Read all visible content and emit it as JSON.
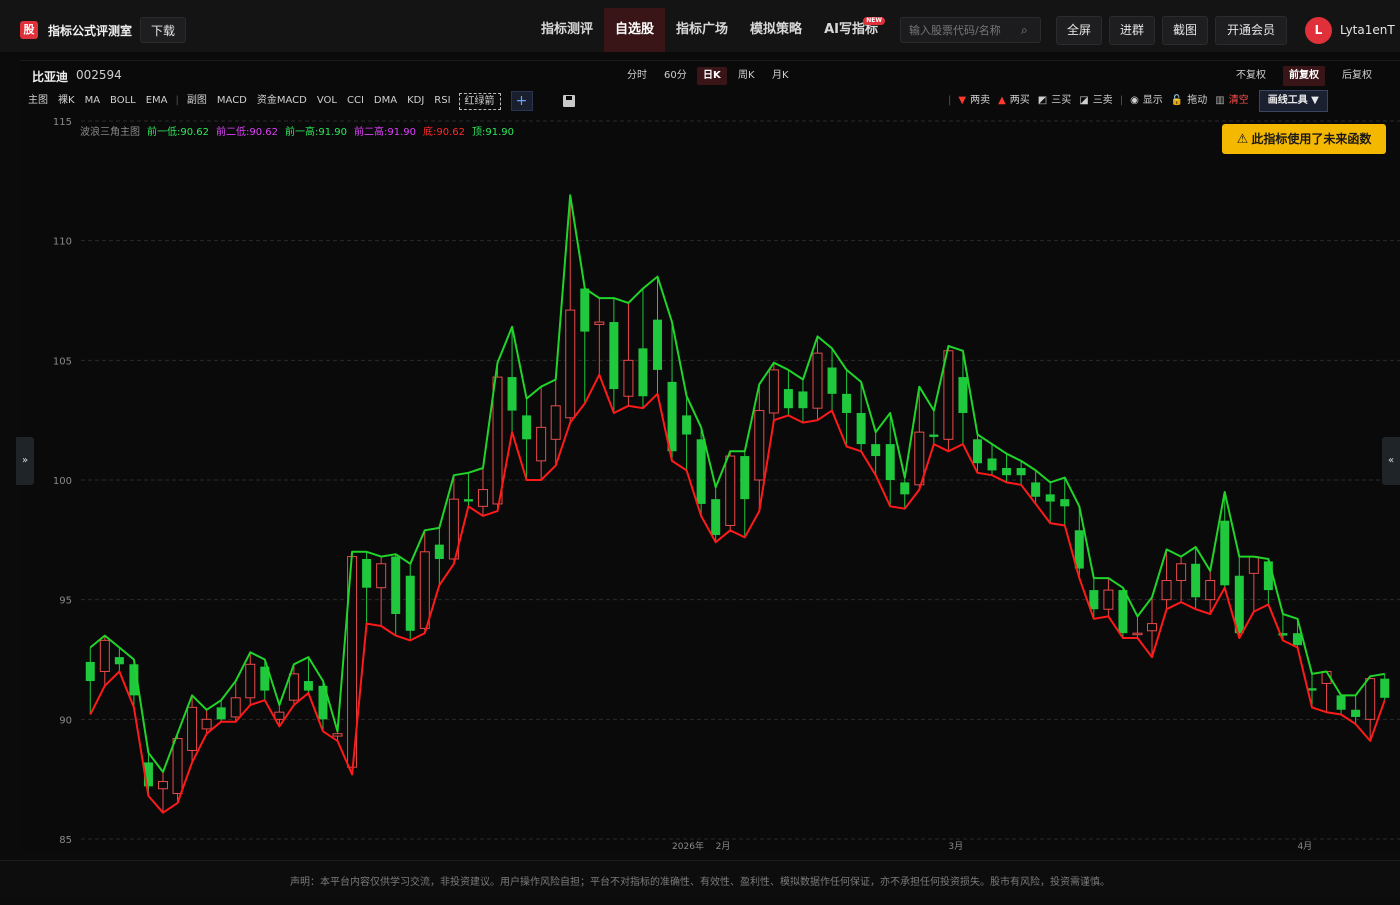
{
  "app": {
    "logo_char": "股",
    "title": "指标公式评测室",
    "download_label": "下载"
  },
  "nav": [
    {
      "label": "指标测评",
      "active": false
    },
    {
      "label": "自选股",
      "active": true
    },
    {
      "label": "指标广场",
      "active": false
    },
    {
      "label": "模拟策略",
      "active": false
    },
    {
      "label": "AI写指标",
      "active": false,
      "badge": "NEW"
    }
  ],
  "search": {
    "placeholder": "输入股票代码/名称"
  },
  "actions": {
    "fullscreen": "全屏",
    "join_group": "进群",
    "screenshot": "截图",
    "vip": "开通会员"
  },
  "user": {
    "initial": "L",
    "name": "Lyta1enT"
  },
  "stock": {
    "name": "比亚迪",
    "code": "002594"
  },
  "periods": [
    {
      "label": "分时",
      "active": false
    },
    {
      "label": "60分",
      "active": false
    },
    {
      "label": "日K",
      "active": true
    },
    {
      "label": "周K",
      "active": false
    },
    {
      "label": "月K",
      "active": false
    }
  ],
  "adjust": [
    {
      "label": "不复权",
      "active": false
    },
    {
      "label": "前复权",
      "active": true
    },
    {
      "label": "后复权",
      "active": false
    }
  ],
  "indicators": {
    "main_group": [
      "主图",
      "裸K",
      "MA",
      "BOLL",
      "EMA"
    ],
    "sub_group": [
      "副图",
      "MACD",
      "资金MACD",
      "VOL",
      "CCI",
      "DMA",
      "KDJ",
      "RSI"
    ],
    "boxed": "红绿箭",
    "add": "+"
  },
  "draw_tools": {
    "items": [
      {
        "glyph": "▼",
        "label": "两卖",
        "color": "#ff3b30"
      },
      {
        "glyph": "▲",
        "label": "两买",
        "color": "#ff3b30"
      },
      {
        "glyph": "◩",
        "label": "三买",
        "color": "#d0d0d0"
      },
      {
        "glyph": "◪",
        "label": "三卖",
        "color": "#d0d0d0"
      },
      {
        "glyph": "◉",
        "label": "显示",
        "color": "#d0d0d0"
      },
      {
        "glyph": "🔓",
        "label": "拖动",
        "color": "#d0d0d0"
      },
      {
        "glyph": "▥",
        "label": "清空",
        "color": "#ff4d4d"
      }
    ],
    "menu_label": "画线工具 ▼"
  },
  "warning": {
    "text": "此指标使用了未来函数"
  },
  "legend": {
    "title": "波浪三角主图",
    "items": [
      {
        "text": "前一低:90.62",
        "color": "#2ee85a"
      },
      {
        "text": "前二低:90.62",
        "color": "#e040fb"
      },
      {
        "text": "前一高:91.90",
        "color": "#2ee85a"
      },
      {
        "text": "前二高:91.90",
        "color": "#e040fb"
      },
      {
        "text": "底:90.62",
        "color": "#ff2a2a"
      },
      {
        "text": "顶:91.90",
        "color": "#2ee85a"
      }
    ]
  },
  "sidebar": {
    "left_toggle": "»",
    "right_toggle": "«"
  },
  "footer": {
    "text": "声明：本平台内容仅供学习交流，非投资建议。用户操作风险自担；平台不对指标的准确性、有效性、盈利性、模拟数据作任何保证，亦不承担任何投资损失。股市有风险，投资需谨慎。"
  },
  "colors": {
    "up": "#e84a4a",
    "down": "#1fc83c",
    "upper_line": "#21d42a",
    "lower_line": "#ff1a1a",
    "accent": "#e0303a",
    "warning": "#f5b800"
  },
  "chart_data": {
    "type": "candlestick",
    "ylim": [
      85,
      115
    ],
    "yticks": [
      85,
      90,
      95,
      100,
      105,
      110,
      115
    ],
    "x_month_labels": [
      {
        "index": 40,
        "label": "2026年"
      },
      {
        "index": 43,
        "label": "2月"
      },
      {
        "index": 59,
        "label": "3月"
      },
      {
        "index": 83,
        "label": "4月"
      }
    ],
    "candles": [
      [
        92.4,
        91.6,
        93.0,
        90.2
      ],
      [
        92.0,
        93.3,
        93.5,
        91.4
      ],
      [
        92.6,
        92.3,
        93.0,
        92.0
      ],
      [
        92.3,
        91.0,
        92.5,
        90.5
      ],
      [
        88.2,
        87.2,
        88.6,
        86.8
      ],
      [
        87.1,
        87.4,
        87.8,
        86.1
      ],
      [
        86.9,
        89.2,
        89.4,
        86.5
      ],
      [
        88.7,
        90.5,
        91.0,
        88.2
      ],
      [
        89.6,
        90.0,
        90.4,
        89.4
      ],
      [
        90.5,
        90.0,
        90.8,
        89.9
      ],
      [
        90.1,
        90.9,
        91.6,
        89.9
      ],
      [
        90.9,
        92.3,
        92.8,
        90.6
      ],
      [
        92.2,
        91.2,
        92.5,
        90.8
      ],
      [
        90.0,
        90.3,
        90.6,
        89.7
      ],
      [
        90.8,
        91.9,
        92.3,
        90.6
      ],
      [
        91.6,
        91.2,
        92.6,
        91.1
      ],
      [
        91.4,
        90.0,
        91.6,
        89.5
      ],
      [
        89.3,
        89.4,
        89.5,
        89.1
      ],
      [
        88.0,
        96.8,
        97.0,
        87.7
      ],
      [
        96.7,
        95.5,
        97.0,
        94.0
      ],
      [
        95.5,
        96.5,
        96.8,
        93.9
      ],
      [
        96.8,
        94.4,
        96.9,
        93.5
      ],
      [
        96.0,
        93.7,
        96.5,
        93.3
      ],
      [
        93.8,
        97.0,
        97.9,
        93.6
      ],
      [
        97.3,
        96.7,
        98.0,
        95.6
      ],
      [
        96.7,
        99.2,
        100.2,
        96.5
      ],
      [
        99.2,
        99.1,
        100.3,
        98.9
      ],
      [
        98.9,
        99.6,
        100.5,
        98.5
      ],
      [
        99.0,
        104.3,
        104.9,
        98.7
      ],
      [
        104.3,
        102.9,
        106.4,
        102.0
      ],
      [
        102.7,
        101.7,
        103.4,
        100.0
      ],
      [
        100.8,
        102.2,
        103.9,
        100.0
      ],
      [
        101.7,
        103.1,
        104.2,
        100.6
      ],
      [
        102.6,
        107.1,
        111.9,
        102.4
      ],
      [
        108.0,
        106.2,
        108.0,
        103.2
      ],
      [
        106.5,
        106.6,
        107.6,
        104.4
      ],
      [
        106.6,
        103.8,
        107.6,
        102.8
      ],
      [
        103.5,
        105.0,
        107.4,
        103.1
      ],
      [
        105.5,
        103.5,
        108.0,
        103.0
      ],
      [
        106.7,
        104.6,
        108.5,
        103.6
      ],
      [
        104.1,
        101.2,
        106.6,
        100.8
      ],
      [
        102.7,
        101.9,
        103.5,
        100.4
      ],
      [
        101.7,
        99.0,
        102.2,
        98.5
      ],
      [
        99.2,
        97.7,
        99.7,
        97.4
      ],
      [
        98.1,
        101.0,
        101.2,
        97.9
      ],
      [
        101.0,
        99.2,
        101.2,
        97.6
      ],
      [
        100.0,
        102.9,
        104.0,
        98.7
      ],
      [
        102.8,
        104.6,
        104.9,
        102.5
      ],
      [
        103.8,
        103.0,
        104.6,
        102.7
      ],
      [
        103.7,
        103.0,
        104.2,
        102.4
      ],
      [
        103.0,
        105.3,
        106.0,
        102.5
      ],
      [
        104.7,
        103.6,
        105.5,
        102.9
      ],
      [
        103.6,
        102.8,
        104.6,
        101.4
      ],
      [
        102.8,
        101.5,
        104.1,
        101.2
      ],
      [
        101.5,
        101.0,
        102.0,
        100.2
      ],
      [
        101.5,
        100.0,
        102.8,
        98.9
      ],
      [
        99.9,
        99.4,
        100.1,
        98.8
      ],
      [
        99.8,
        102.0,
        103.9,
        99.6
      ],
      [
        101.9,
        101.8,
        102.9,
        101.5
      ],
      [
        101.7,
        105.4,
        105.6,
        101.2
      ],
      [
        104.3,
        102.8,
        105.4,
        101.5
      ],
      [
        101.7,
        100.7,
        101.9,
        100.3
      ],
      [
        100.9,
        100.4,
        101.5,
        100.2
      ],
      [
        100.5,
        100.2,
        101.1,
        99.9
      ],
      [
        100.5,
        100.2,
        100.8,
        99.8
      ],
      [
        99.9,
        99.3,
        100.4,
        99.0
      ],
      [
        99.4,
        99.1,
        99.9,
        98.2
      ],
      [
        99.2,
        98.9,
        100.1,
        98.1
      ],
      [
        97.9,
        96.3,
        98.9,
        95.9
      ],
      [
        95.4,
        94.6,
        95.9,
        94.2
      ],
      [
        94.6,
        95.4,
        95.9,
        94.3
      ],
      [
        95.4,
        93.6,
        95.5,
        93.4
      ],
      [
        93.6,
        93.6,
        94.3,
        93.4
      ],
      [
        93.7,
        94.0,
        95.1,
        92.6
      ],
      [
        95.0,
        95.8,
        97.1,
        94.6
      ],
      [
        95.8,
        96.5,
        96.8,
        94.9
      ],
      [
        96.5,
        95.1,
        97.2,
        94.6
      ],
      [
        95.0,
        95.8,
        96.2,
        94.4
      ],
      [
        98.3,
        95.6,
        99.5,
        95.5
      ],
      [
        96.0,
        93.6,
        96.8,
        93.4
      ],
      [
        96.1,
        96.8,
        96.8,
        94.5
      ],
      [
        96.6,
        95.4,
        96.7,
        94.8
      ],
      [
        93.6,
        93.5,
        94.4,
        93.3
      ],
      [
        93.6,
        93.1,
        94.2,
        93.0
      ],
      [
        91.3,
        91.2,
        91.9,
        90.5
      ],
      [
        91.5,
        92.0,
        92.0,
        90.3
      ],
      [
        91.0,
        90.4,
        91.0,
        90.2
      ],
      [
        90.4,
        90.1,
        91.0,
        89.8
      ],
      [
        90.0,
        91.7,
        91.8,
        89.1
      ],
      [
        91.7,
        90.9,
        91.9,
        90.8
      ]
    ]
  }
}
